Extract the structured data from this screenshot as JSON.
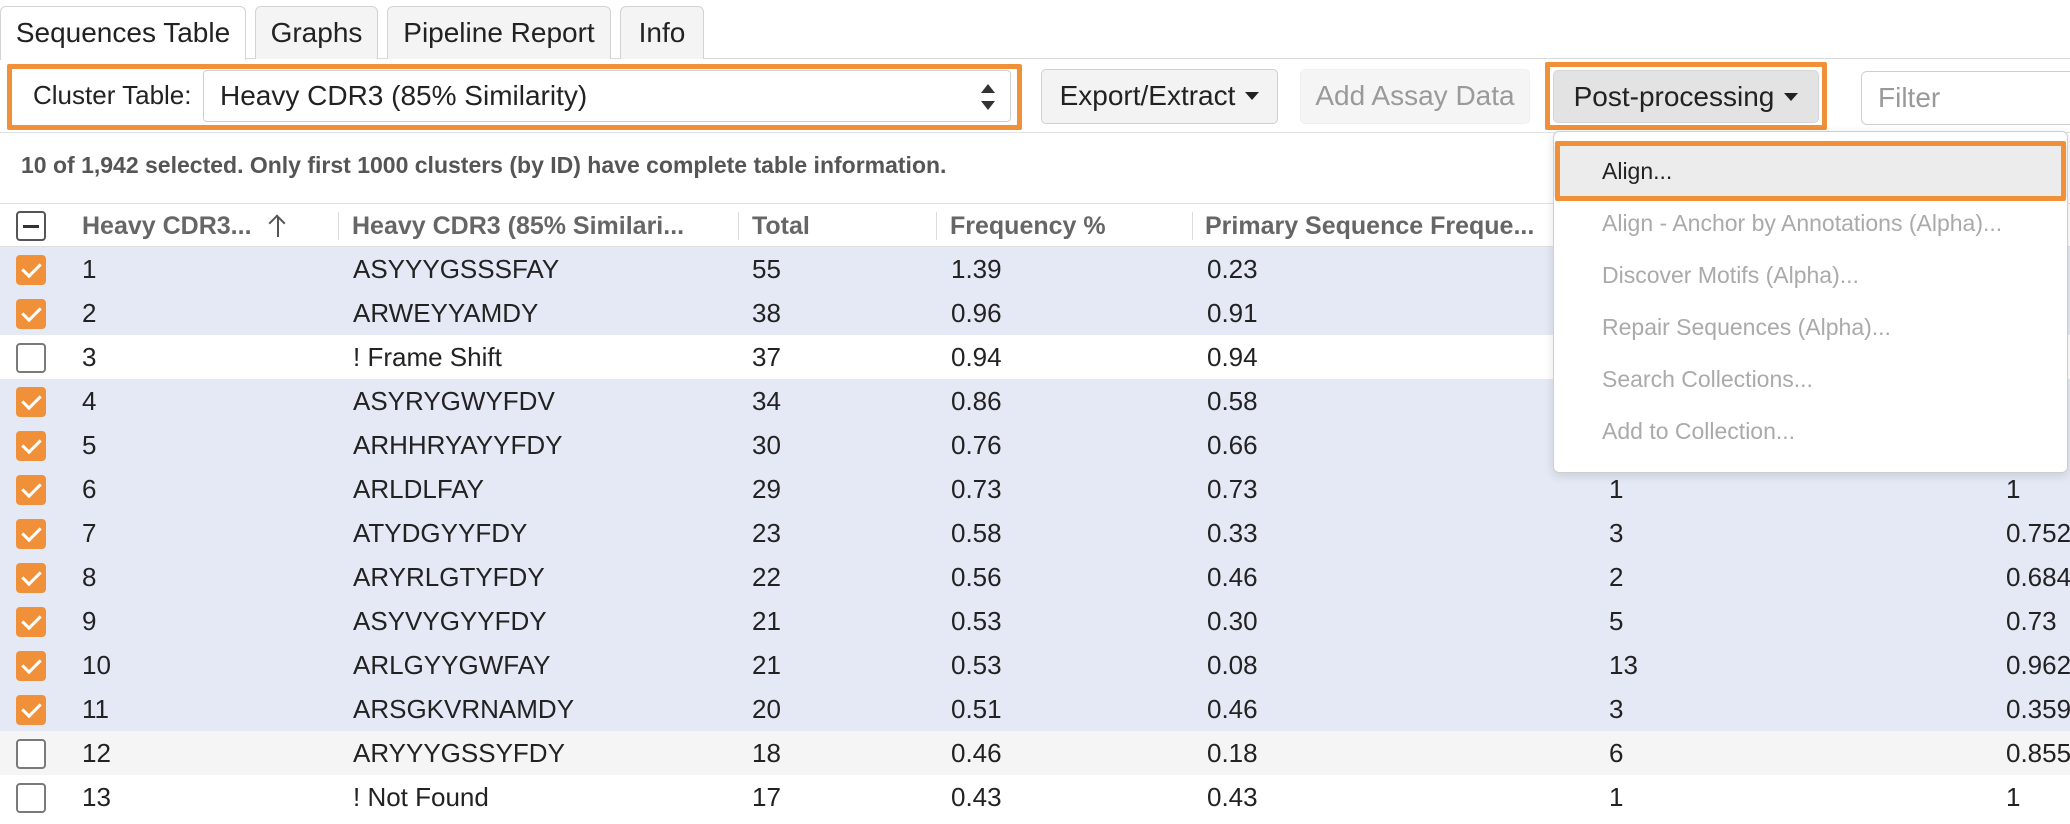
{
  "tabs": [
    {
      "label": "Sequences Table",
      "active": true
    },
    {
      "label": "Graphs",
      "active": false
    },
    {
      "label": "Pipeline Report",
      "active": false
    },
    {
      "label": "Info",
      "active": false
    }
  ],
  "toolbar": {
    "cluster_label": "Cluster Table:",
    "cluster_value": "Heavy CDR3 (85% Similarity)",
    "export_label": "Export/Extract",
    "add_assay_label": "Add Assay Data",
    "postprocessing_label": "Post-processing",
    "filter_placeholder": "Filter"
  },
  "status_text": "10 of 1,942 selected. Only first 1000 clusters (by ID) have complete table information.",
  "table": {
    "headers": [
      "Heavy CDR3...",
      "Heavy CDR3 (85% Similari...",
      "Total",
      "Frequency %",
      "Primary Sequence Freque..."
    ],
    "rows": [
      {
        "id": "1",
        "cdr3": "ASYYYGSSSFAY",
        "total": "55",
        "freq": "1.39",
        "primary": "0.23",
        "c6": "",
        "c7": "",
        "checked": true
      },
      {
        "id": "2",
        "cdr3": "ARWEYYAMDY",
        "total": "38",
        "freq": "0.96",
        "primary": "0.91",
        "c6": "",
        "c7": "",
        "checked": true
      },
      {
        "id": "3",
        "cdr3": "! Frame Shift",
        "total": "37",
        "freq": "0.94",
        "primary": "0.94",
        "c6": "",
        "c7": "",
        "checked": false
      },
      {
        "id": "4",
        "cdr3": "ASYRYGWYFDV",
        "total": "34",
        "freq": "0.86",
        "primary": "0.58",
        "c6": "",
        "c7": "",
        "checked": true
      },
      {
        "id": "5",
        "cdr3": "ARHHRYAYYFDY",
        "total": "30",
        "freq": "0.76",
        "primary": "0.66",
        "c6": "",
        "c7": "",
        "checked": true
      },
      {
        "id": "6",
        "cdr3": "ARLDLFAY",
        "total": "29",
        "freq": "0.73",
        "primary": "0.73",
        "c6": "1",
        "c7": "1",
        "checked": true
      },
      {
        "id": "7",
        "cdr3": "ATYDGYYFDY",
        "total": "23",
        "freq": "0.58",
        "primary": "0.33",
        "c6": "3",
        "c7": "0.752",
        "checked": true
      },
      {
        "id": "8",
        "cdr3": "ARYRLGTYFDY",
        "total": "22",
        "freq": "0.56",
        "primary": "0.46",
        "c6": "2",
        "c7": "0.684",
        "checked": true
      },
      {
        "id": "9",
        "cdr3": "ASYVYGYYFDY",
        "total": "21",
        "freq": "0.53",
        "primary": "0.30",
        "c6": "5",
        "c7": "0.73",
        "checked": true
      },
      {
        "id": "10",
        "cdr3": "ARLGYYGWFAY",
        "total": "21",
        "freq": "0.53",
        "primary": "0.08",
        "c6": "13",
        "c7": "0.962",
        "checked": true
      },
      {
        "id": "11",
        "cdr3": "ARSGKVRNAMDY",
        "total": "20",
        "freq": "0.51",
        "primary": "0.46",
        "c6": "3",
        "c7": "0.359",
        "checked": true
      },
      {
        "id": "12",
        "cdr3": "ARYYYGSSYFDY",
        "total": "18",
        "freq": "0.46",
        "primary": "0.18",
        "c6": "6",
        "c7": "0.855",
        "checked": false
      },
      {
        "id": "13",
        "cdr3": "! Not Found",
        "total": "17",
        "freq": "0.43",
        "primary": "0.43",
        "c6": "1",
        "c7": "1",
        "checked": false
      }
    ]
  },
  "menu": {
    "items": [
      {
        "label": "Align...",
        "enabled": true
      },
      {
        "label": "Align - Anchor by Annotations (Alpha)...",
        "enabled": false
      },
      {
        "label": "Discover Motifs (Alpha)...",
        "enabled": false
      },
      {
        "label": "Repair Sequences (Alpha)...",
        "enabled": false
      },
      {
        "label": "Search Collections...",
        "enabled": false
      },
      {
        "label": "Add to Collection...",
        "enabled": false
      }
    ]
  },
  "colors": {
    "accent": "#f0913a",
    "selected_row": "#e4e9f5"
  }
}
